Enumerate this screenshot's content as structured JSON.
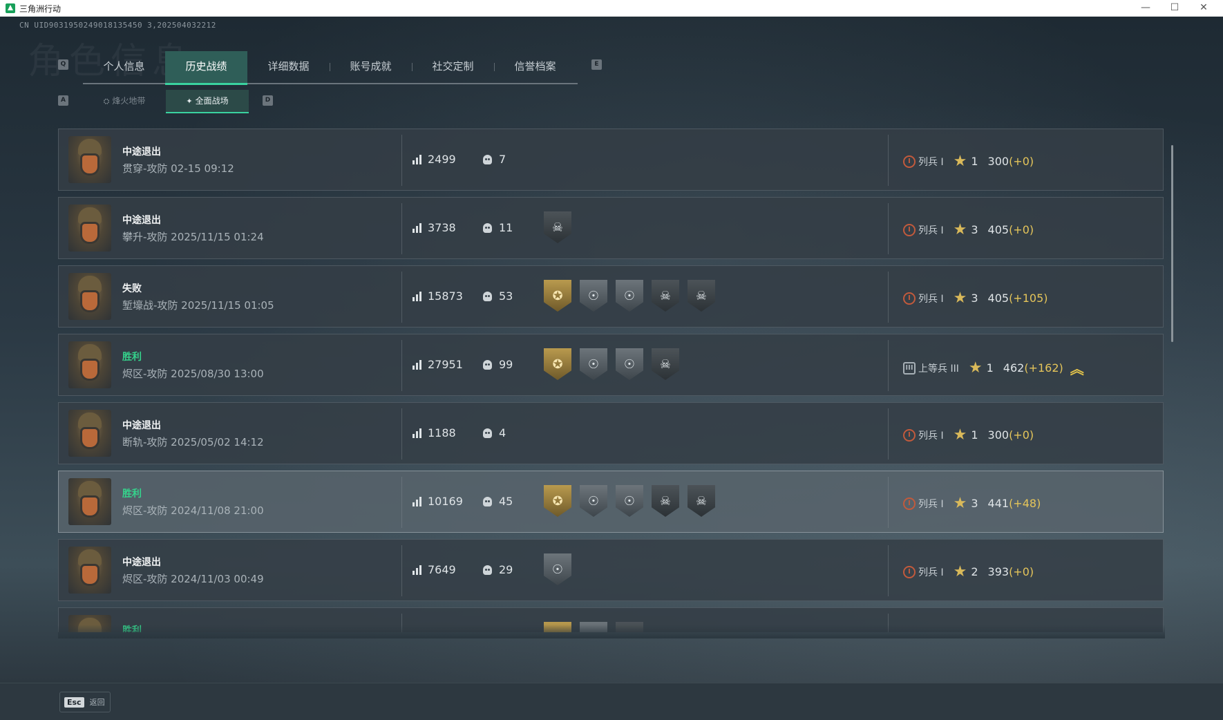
{
  "window": {
    "title": "三角洲行动",
    "minimize": "—",
    "maximize": "☐",
    "close": "✕"
  },
  "watermark": "角色信息",
  "uid": "CN UID9031950249018135450 3,202504032212",
  "tabs": {
    "prev_key": "Q",
    "next_key": "E",
    "items": [
      {
        "label": "个人信息",
        "active": false
      },
      {
        "label": "历史战绩",
        "active": true
      },
      {
        "label": "详细数据",
        "active": false
      },
      {
        "label": "账号成就",
        "active": false
      },
      {
        "label": "社交定制",
        "active": false
      },
      {
        "label": "信誉档案",
        "active": false
      }
    ]
  },
  "subtabs": {
    "prev_key": "A",
    "next_key": "D",
    "items": [
      {
        "label": "烽火地带",
        "active": false
      },
      {
        "label": "全面战场",
        "active": true
      }
    ]
  },
  "records": [
    {
      "status": "中途退出",
      "win": false,
      "map": "贯穿-攻防 02-15 09:12",
      "score": "2499",
      "kills": "7",
      "badges": [],
      "rank": "列兵 I",
      "rank_roman": "I",
      "level": "1",
      "points": "300",
      "delta": "(+0)",
      "rankup": false,
      "highlight": false
    },
    {
      "status": "中途退出",
      "win": false,
      "map": "攀升-攻防 2025/11/15 01:24",
      "score": "3738",
      "kills": "11",
      "badges": [
        "dark"
      ],
      "rank": "列兵 I",
      "rank_roman": "I",
      "level": "3",
      "points": "405",
      "delta": "(+0)",
      "rankup": false,
      "highlight": false
    },
    {
      "status": "失败",
      "win": false,
      "map": "堑壕战-攻防 2025/11/15 01:05",
      "score": "15873",
      "kills": "53",
      "badges": [
        "gold",
        "silver",
        "silver",
        "dark",
        "dark"
      ],
      "rank": "列兵 I",
      "rank_roman": "I",
      "level": "3",
      "points": "405",
      "delta": "(+105)",
      "rankup": false,
      "highlight": false
    },
    {
      "status": "胜利",
      "win": true,
      "map": "烬区-攻防 2025/08/30 13:00",
      "score": "27951",
      "kills": "99",
      "badges": [
        "gold",
        "silver",
        "silver",
        "dark"
      ],
      "rank": "上等兵 III",
      "rank_roman": "III",
      "level": "1",
      "points": "462",
      "delta": "(+162)",
      "rankup": true,
      "highlight": false
    },
    {
      "status": "中途退出",
      "win": false,
      "map": "断轨-攻防 2025/05/02 14:12",
      "score": "1188",
      "kills": "4",
      "badges": [],
      "rank": "列兵 I",
      "rank_roman": "I",
      "level": "1",
      "points": "300",
      "delta": "(+0)",
      "rankup": false,
      "highlight": false
    },
    {
      "status": "胜利",
      "win": true,
      "map": "烬区-攻防 2024/11/08 21:00",
      "score": "10169",
      "kills": "45",
      "badges": [
        "gold",
        "silver",
        "silver",
        "dark",
        "dark"
      ],
      "rank": "列兵 I",
      "rank_roman": "I",
      "level": "3",
      "points": "441",
      "delta": "(+48)",
      "rankup": false,
      "highlight": true
    },
    {
      "status": "中途退出",
      "win": false,
      "map": "烬区-攻防 2024/11/03 00:49",
      "score": "7649",
      "kills": "29",
      "badges": [
        "silver"
      ],
      "rank": "列兵 I",
      "rank_roman": "I",
      "level": "2",
      "points": "393",
      "delta": "(+0)",
      "rankup": false,
      "highlight": false
    },
    {
      "status": "胜利",
      "win": true,
      "map": "",
      "score": "",
      "kills": "",
      "badges": [
        "gold",
        "silver",
        "dark"
      ],
      "rank": "",
      "rank_roman": "",
      "level": "",
      "points": "",
      "delta": "",
      "rankup": false,
      "highlight": false
    }
  ],
  "footer": {
    "esc_key": "Esc",
    "back_label": "返回"
  },
  "colors": {
    "accent": "#3ad3a0",
    "win": "#35d38c",
    "delta": "#e5c55a",
    "rank_icon": "#c25a3c"
  }
}
